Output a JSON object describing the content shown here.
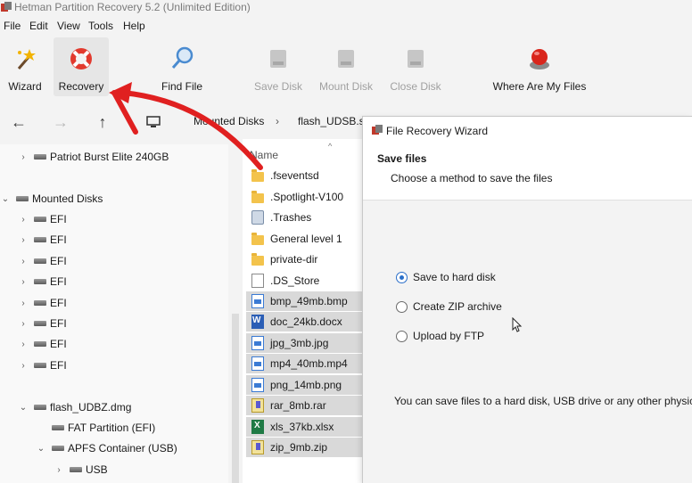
{
  "window": {
    "title": "Hetman Partition Recovery 5.2 (Unlimited Edition)"
  },
  "menu": [
    "File",
    "Edit",
    "View",
    "Tools",
    "Help"
  ],
  "toolbar": {
    "wizard": "Wizard",
    "recovery": "Recovery",
    "find_file": "Find File",
    "save_disk": "Save Disk",
    "mount_disk": "Mount Disk",
    "close_disk": "Close Disk",
    "where_are": "Where Are My Files"
  },
  "breadcrumb": [
    "Mounted Disks",
    "flash_UDSB.sp"
  ],
  "tree": [
    {
      "label": "Patriot Burst Elite 240GB",
      "state": "collapsed"
    },
    {
      "label": "Mounted Disks",
      "state": "expanded"
    },
    {
      "label": "EFI",
      "state": "collapsed"
    },
    {
      "label": "EFI",
      "state": "collapsed"
    },
    {
      "label": "EFI",
      "state": "collapsed"
    },
    {
      "label": "EFI",
      "state": "collapsed"
    },
    {
      "label": "EFI",
      "state": "collapsed"
    },
    {
      "label": "EFI",
      "state": "collapsed"
    },
    {
      "label": "EFI",
      "state": "collapsed"
    },
    {
      "label": "EFI",
      "state": "collapsed"
    },
    {
      "label": "flash_UDBZ.dmg",
      "state": "expanded"
    },
    {
      "label": "FAT Partition (EFI)",
      "state": "none"
    },
    {
      "label": "APFS Container (USB)",
      "state": "expanded"
    },
    {
      "label": "USB",
      "state": "collapsed"
    }
  ],
  "files": {
    "column_name": "Name",
    "items": [
      {
        "name": ".fseventsd",
        "icon": "folder-icon",
        "selected": false
      },
      {
        "name": ".Spotlight-V100",
        "icon": "folder-icon",
        "selected": false
      },
      {
        "name": ".Trashes",
        "icon": "trash-icon",
        "selected": false
      },
      {
        "name": "General level 1",
        "icon": "folder-icon",
        "selected": false
      },
      {
        "name": "private-dir",
        "icon": "folder-icon",
        "selected": false
      },
      {
        "name": ".DS_Store",
        "icon": "file-icon",
        "selected": false
      },
      {
        "name": "bmp_49mb.bmp",
        "icon": "image-file-icon",
        "selected": true
      },
      {
        "name": "doc_24kb.docx",
        "icon": "word-file-icon",
        "selected": true
      },
      {
        "name": "jpg_3mb.jpg",
        "icon": "image-file-icon",
        "selected": true
      },
      {
        "name": "mp4_40mb.mp4",
        "icon": "image-file-icon",
        "selected": true
      },
      {
        "name": "png_14mb.png",
        "icon": "image-file-icon",
        "selected": true
      },
      {
        "name": "rar_8mb.rar",
        "icon": "archive-file-icon",
        "selected": true
      },
      {
        "name": "xls_37kb.xlsx",
        "icon": "excel-file-icon",
        "selected": true
      },
      {
        "name": "zip_9mb.zip",
        "icon": "archive-file-icon",
        "selected": true
      }
    ]
  },
  "wizard": {
    "title": "File Recovery Wizard",
    "heading": "Save files",
    "subheading": "Choose a method to save the files",
    "options": [
      {
        "label": "Save to hard disk",
        "checked": true
      },
      {
        "label": "Create ZIP archive",
        "checked": false
      },
      {
        "label": "Upload by FTP",
        "checked": false
      }
    ],
    "description": "You can save files to a hard disk, USB drive or any other physical d"
  },
  "colors": {
    "annotation_arrow": "#e02020",
    "selection": "#d9d9d9",
    "radio_accent": "#2b6fc9"
  }
}
